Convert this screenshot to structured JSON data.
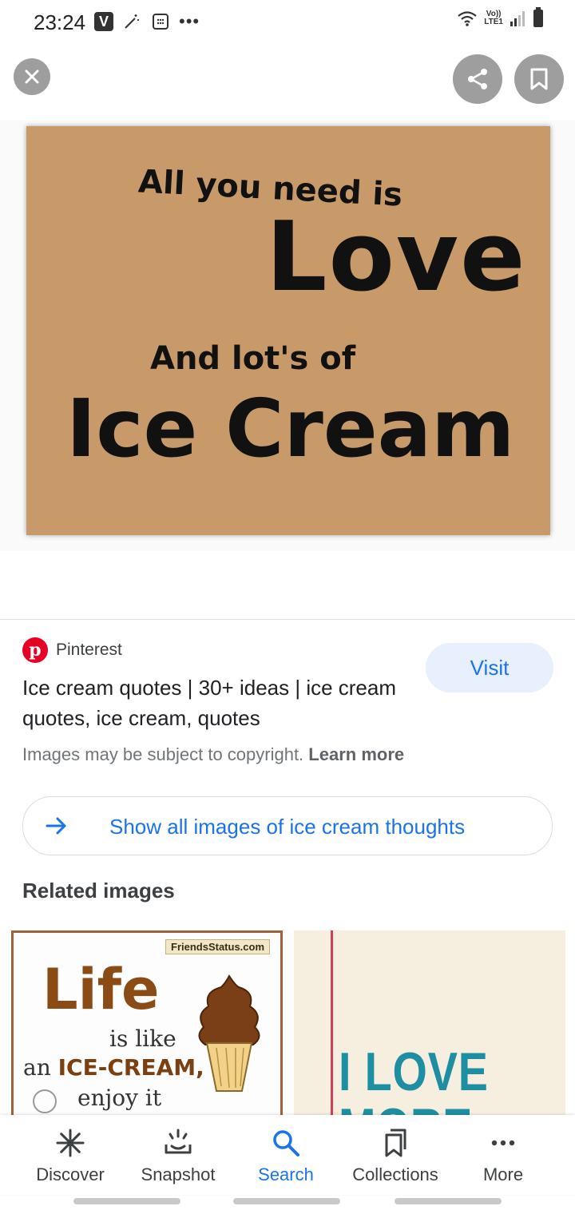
{
  "status_bar": {
    "time": "23:24",
    "app_badge": "V",
    "more_notifications": "•••",
    "network_label_top": "Vo))",
    "network_label_bottom": "LTE1"
  },
  "top_actions": {
    "close_icon": "close-icon",
    "share_icon": "share-icon",
    "save_icon": "bookmark-icon"
  },
  "image_preview": {
    "line1": "All you need is",
    "line2": "Love",
    "line3": "And lot's of",
    "line4": "Ice Cream"
  },
  "result": {
    "source": "Pinterest",
    "title": "Ice cream quotes | 30+ ideas | ice cream quotes, ice cream, quotes",
    "visit_label": "Visit",
    "copyright_text": "Images may be subject to copyright.",
    "learn_more": "Learn more",
    "show_all_label": "Show all images of ice cream thoughts"
  },
  "related": {
    "heading": "Related images",
    "thumb1": {
      "brand": "FriendsStatus.com",
      "life": "Life",
      "is_like": "is like",
      "an": "an",
      "ice_cream": "ICE-CREAM,",
      "enjoy": "enjoy it"
    },
    "thumb2": {
      "line1": "I LOVE YOU",
      "line2": "MORE THAN"
    }
  },
  "bottom_nav": {
    "items": [
      {
        "label": "Discover",
        "icon": "asterisk-icon"
      },
      {
        "label": "Snapshot",
        "icon": "snapshot-icon"
      },
      {
        "label": "Search",
        "icon": "search-icon"
      },
      {
        "label": "Collections",
        "icon": "collections-icon"
      },
      {
        "label": "More",
        "icon": "more-icon"
      }
    ],
    "active": "Search"
  },
  "colors": {
    "accent": "#1a73e8",
    "visit_bg": "#e8f0fe",
    "pinterest": "#e60023",
    "board": "#c89a6a"
  }
}
